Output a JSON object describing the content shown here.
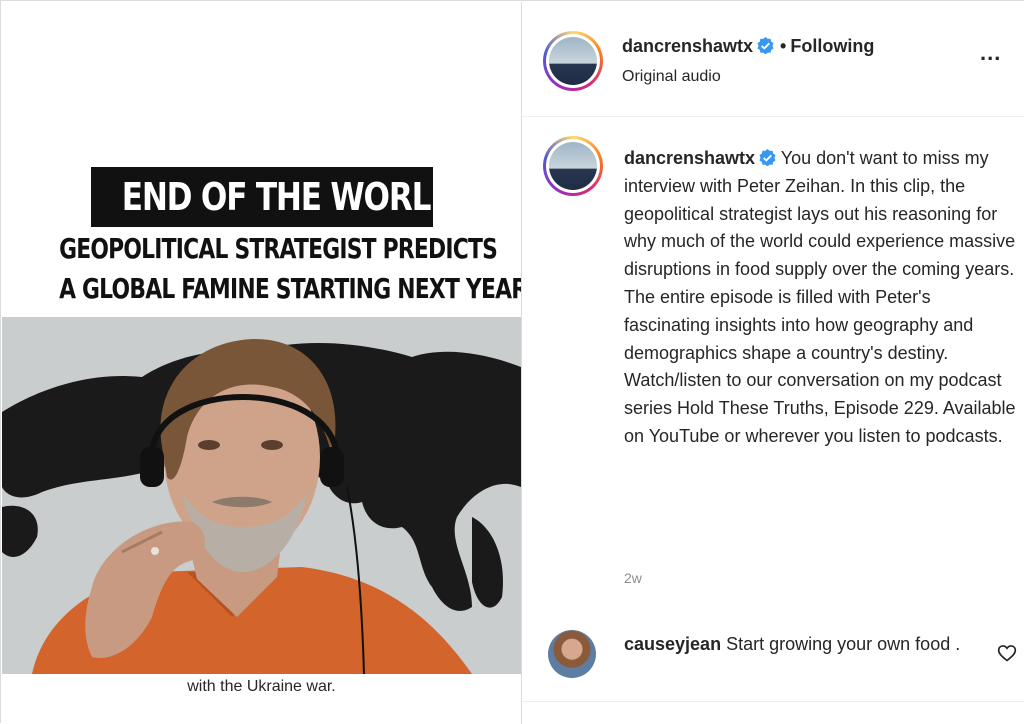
{
  "video": {
    "headline": "END OF THE WORLD",
    "subheadline_line1": "GEOPOLITICAL STRATEGIST PREDICTS",
    "subheadline_line2": "A GLOBAL FAMINE STARTING NEXT YEAR",
    "caption": "with the Ukraine war."
  },
  "header": {
    "username": "dancrenshawtx",
    "separator": "•",
    "follow_status": "Following",
    "audio_label": "Original audio",
    "more_label": "..."
  },
  "post": {
    "username": "dancrenshawtx",
    "text": "You don't want to miss my interview with Peter Zeihan. In this clip, the geopolitical strategist lays out his reasoning for why much of the world could experience massive disruptions in food supply over the coming years. The entire episode is filled with Peter's fascinating insights into how geography and demographics shape a country's destiny. Watch/listen to our conversation on my podcast series Hold These Truths, Episode 229. Available on YouTube or wherever you listen to podcasts.",
    "age": "2w"
  },
  "comments": [
    {
      "username": "causeyjean",
      "text": "Start growing your own food ."
    }
  ],
  "colors": {
    "verified_blue": "#3897f0",
    "shirt_orange": "#d2642c",
    "muted_text": "#8e8e8e"
  }
}
